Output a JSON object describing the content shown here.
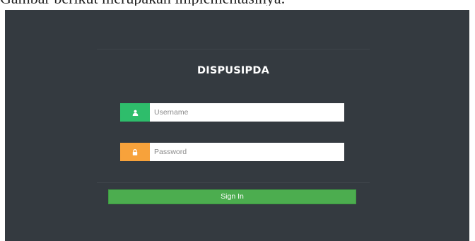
{
  "caption": "Gambar berikut merupakan implementasinya.",
  "login": {
    "title": "DISPUSIPDA",
    "username": {
      "placeholder": "Username",
      "value": "",
      "icon": "user-icon",
      "icon_bg": "#2ebd6b"
    },
    "password": {
      "placeholder": "Password",
      "value": "",
      "icon": "lock-icon",
      "icon_bg": "#f7a23b"
    },
    "signin_label": "Sign In",
    "signin_color": "#4cad4f"
  },
  "colors": {
    "background": "#343a40"
  }
}
